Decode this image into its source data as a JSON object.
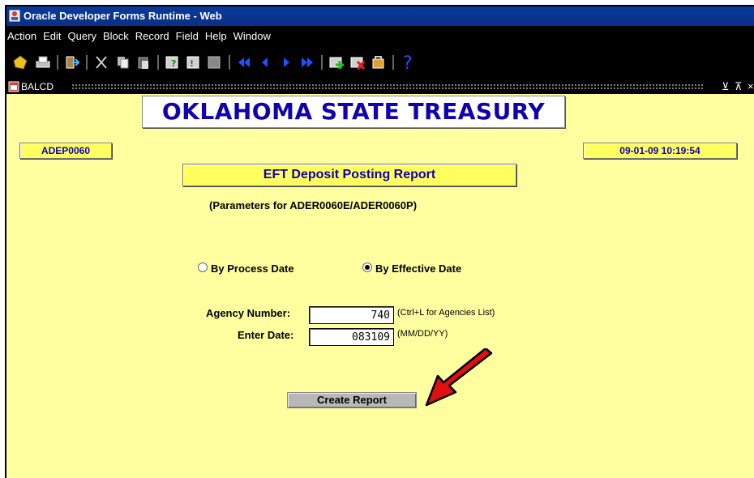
{
  "window": {
    "title": "Oracle Developer Forms Runtime - Web"
  },
  "menu": [
    "Action",
    "Edit",
    "Query",
    "Block",
    "Record",
    "Field",
    "Help",
    "Window"
  ],
  "toolbar": {
    "icons": [
      "save-icon",
      "print-icon",
      "exit-icon",
      "cut-icon",
      "copy-icon",
      "paste-icon",
      "enter-query-icon",
      "execute-query-icon",
      "cancel-query-icon",
      "previous-block-icon",
      "previous-record-icon",
      "next-record-icon",
      "next-block-icon",
      "insert-record-icon",
      "delete-record-icon",
      "lock-record-icon",
      "help-icon"
    ]
  },
  "block": {
    "name": "BALCD"
  },
  "form": {
    "form_id": "ADEP0060",
    "org_title": "OKLAHOMA STATE TREASURY",
    "datetime": "09-01-09 10:19:54",
    "report_title": "EFT Deposit Posting Report",
    "parameters_label": "(Parameters for ADER0060E/ADER0060P)",
    "radio_process": "By Process Date",
    "radio_effective": "By Effective Date",
    "selected_option": "By Effective Date",
    "agency_label": "Agency Number:",
    "agency_value": "740",
    "agency_hint": "(Ctrl+L for Agencies List)",
    "date_label": "Enter Date:",
    "date_value": "083109",
    "date_hint": "(MM/DD/YY)",
    "create_button": "Create Report"
  },
  "colors": {
    "background": "#ffffa0",
    "title_text": "#1000b0",
    "arrow": "#e01010"
  }
}
